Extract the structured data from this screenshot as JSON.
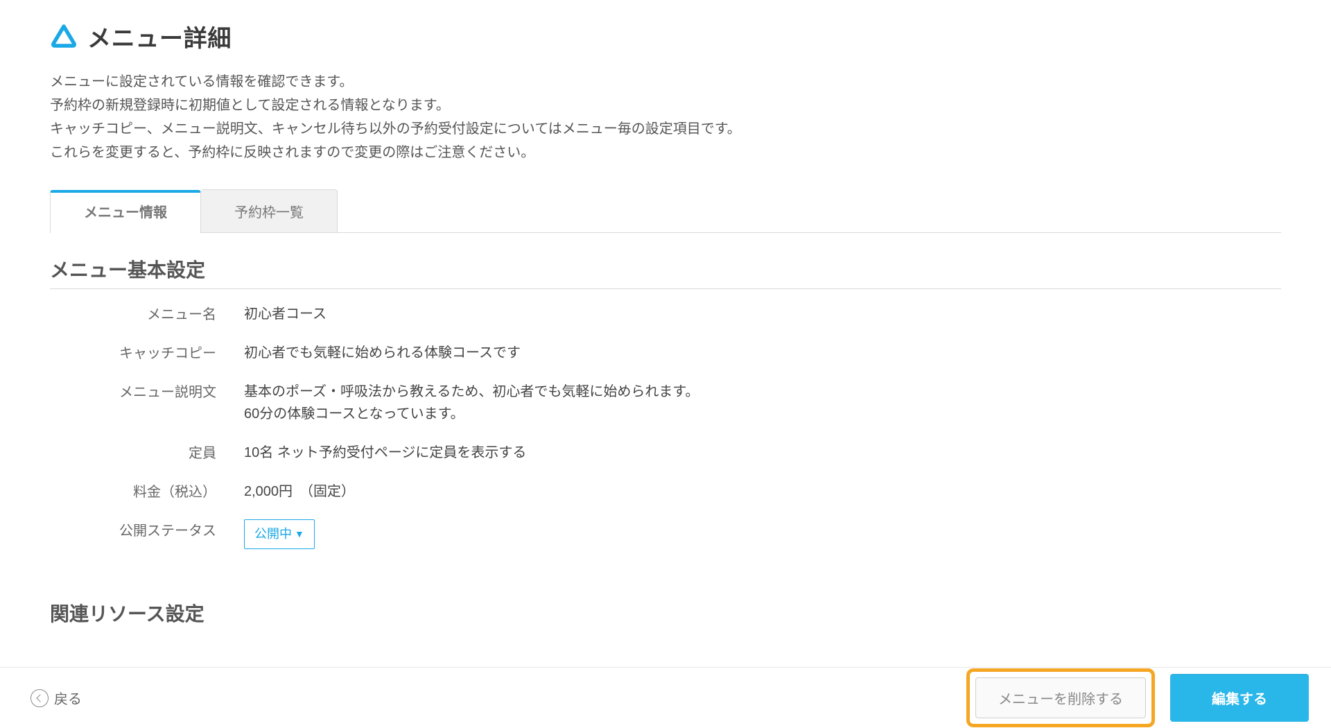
{
  "header": {
    "title": "メニュー詳細"
  },
  "description": {
    "line1": "メニューに設定されている情報を確認できます。",
    "line2": "予約枠の新規登録時に初期値として設定される情報となります。",
    "line3": "キャッチコピー、メニュー説明文、キャンセル待ち以外の予約受付設定についてはメニュー毎の設定項目です。",
    "line4": "これらを変更すると、予約枠に反映されますので変更の際はご注意ください。"
  },
  "tabs": {
    "menu_info": "メニュー情報",
    "slot_list": "予約枠一覧"
  },
  "section1": {
    "title": "メニュー基本設定",
    "fields": {
      "name_label": "メニュー名",
      "name_value": "初心者コース",
      "catch_label": "キャッチコピー",
      "catch_value": "初心者でも気軽に始められる体験コースです",
      "desc_label": "メニュー説明文",
      "desc_value_line1": "基本のポーズ・呼吸法から教えるため、初心者でも気軽に始められます。",
      "desc_value_line2": "60分の体験コースとなっています。",
      "capacity_label": "定員",
      "capacity_value": "10名  ネット予約受付ページに定員を表示する",
      "price_label": "料金（税込）",
      "price_value": "2,000円　（固定）",
      "status_label": "公開ステータス",
      "status_value": "公開中"
    }
  },
  "section2": {
    "title": "関連リソース設定"
  },
  "footer": {
    "back": "戻る",
    "delete": "メニューを削除する",
    "edit": "編集する"
  }
}
